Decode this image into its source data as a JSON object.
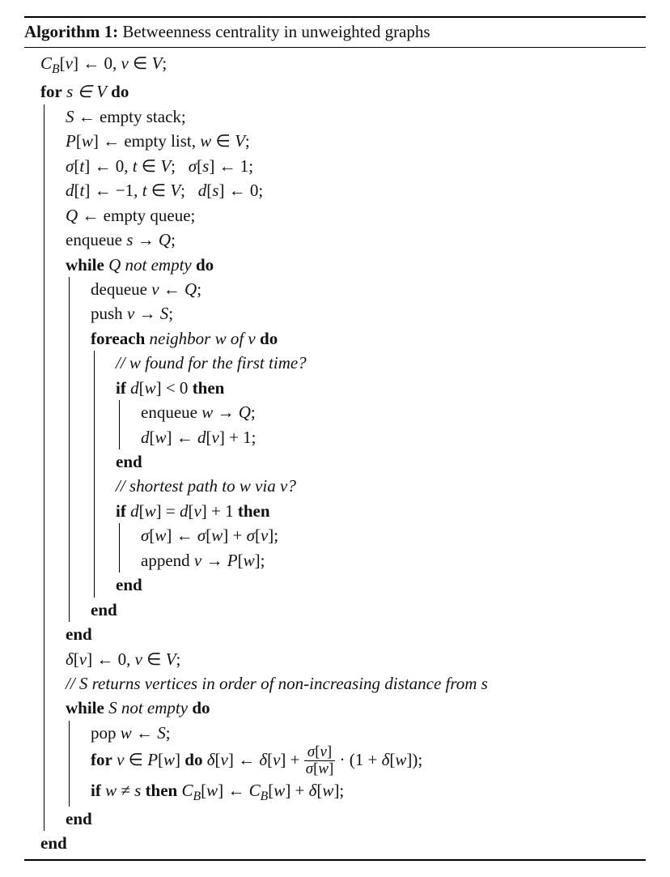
{
  "title_label": "Algorithm 1:",
  "title_text": "Betweenness centrality in unweighted graphs",
  "l1": "C_B[v] ← 0, v ∈ V;",
  "l2a": "for",
  "l2b": "s ∈ V",
  "l2c": "do",
  "l3": "S ← empty stack;",
  "l4": "P[w] ← empty list, w ∈ V;",
  "l5": "σ[t] ← 0, t ∈ V;   σ[s] ← 1;",
  "l6": "d[t] ← −1, t ∈ V;   d[s] ← 0;",
  "l7": "Q ← empty queue;",
  "l8": "enqueue s → Q;",
  "l9a": "while",
  "l9b": "Q not empty",
  "l9c": "do",
  "l10": "dequeue v ← Q;",
  "l11": "push v → S;",
  "l12a": "foreach",
  "l12b": "neighbor w of v",
  "l12c": "do",
  "l13": "// w found for the first time?",
  "l14a": "if",
  "l14b": "d[w] < 0",
  "l14c": "then",
  "l15": "enqueue w → Q;",
  "l16": "d[w] ← d[v] + 1;",
  "end": "end",
  "l18": "// shortest path to w via v?",
  "l19a": "if",
  "l19b": "d[w] = d[v] + 1",
  "l19c": "then",
  "l20": "σ[w] ← σ[w] + σ[v];",
  "l21": "append v → P[w];",
  "l26": "δ[v] ← 0, v ∈ V;",
  "l27": "// S returns vertices in order of non-increasing distance from s",
  "l28a": "while",
  "l28b": "S not empty",
  "l28c": "do",
  "l29": "pop w ← S;",
  "l30a": "for",
  "l30b": "v ∈ P[w]",
  "l30c": "do",
  "l30d": "δ[v] ← δ[v] + ",
  "frac_num": "σ[v]",
  "frac_den": "σ[w]",
  "l30e": " · (1 + δ[w]);",
  "l31a": "if",
  "l31b": "w ≠ s",
  "l31c": "then",
  "l31d": "C_B[w] ← C_B[w] + δ[w];"
}
